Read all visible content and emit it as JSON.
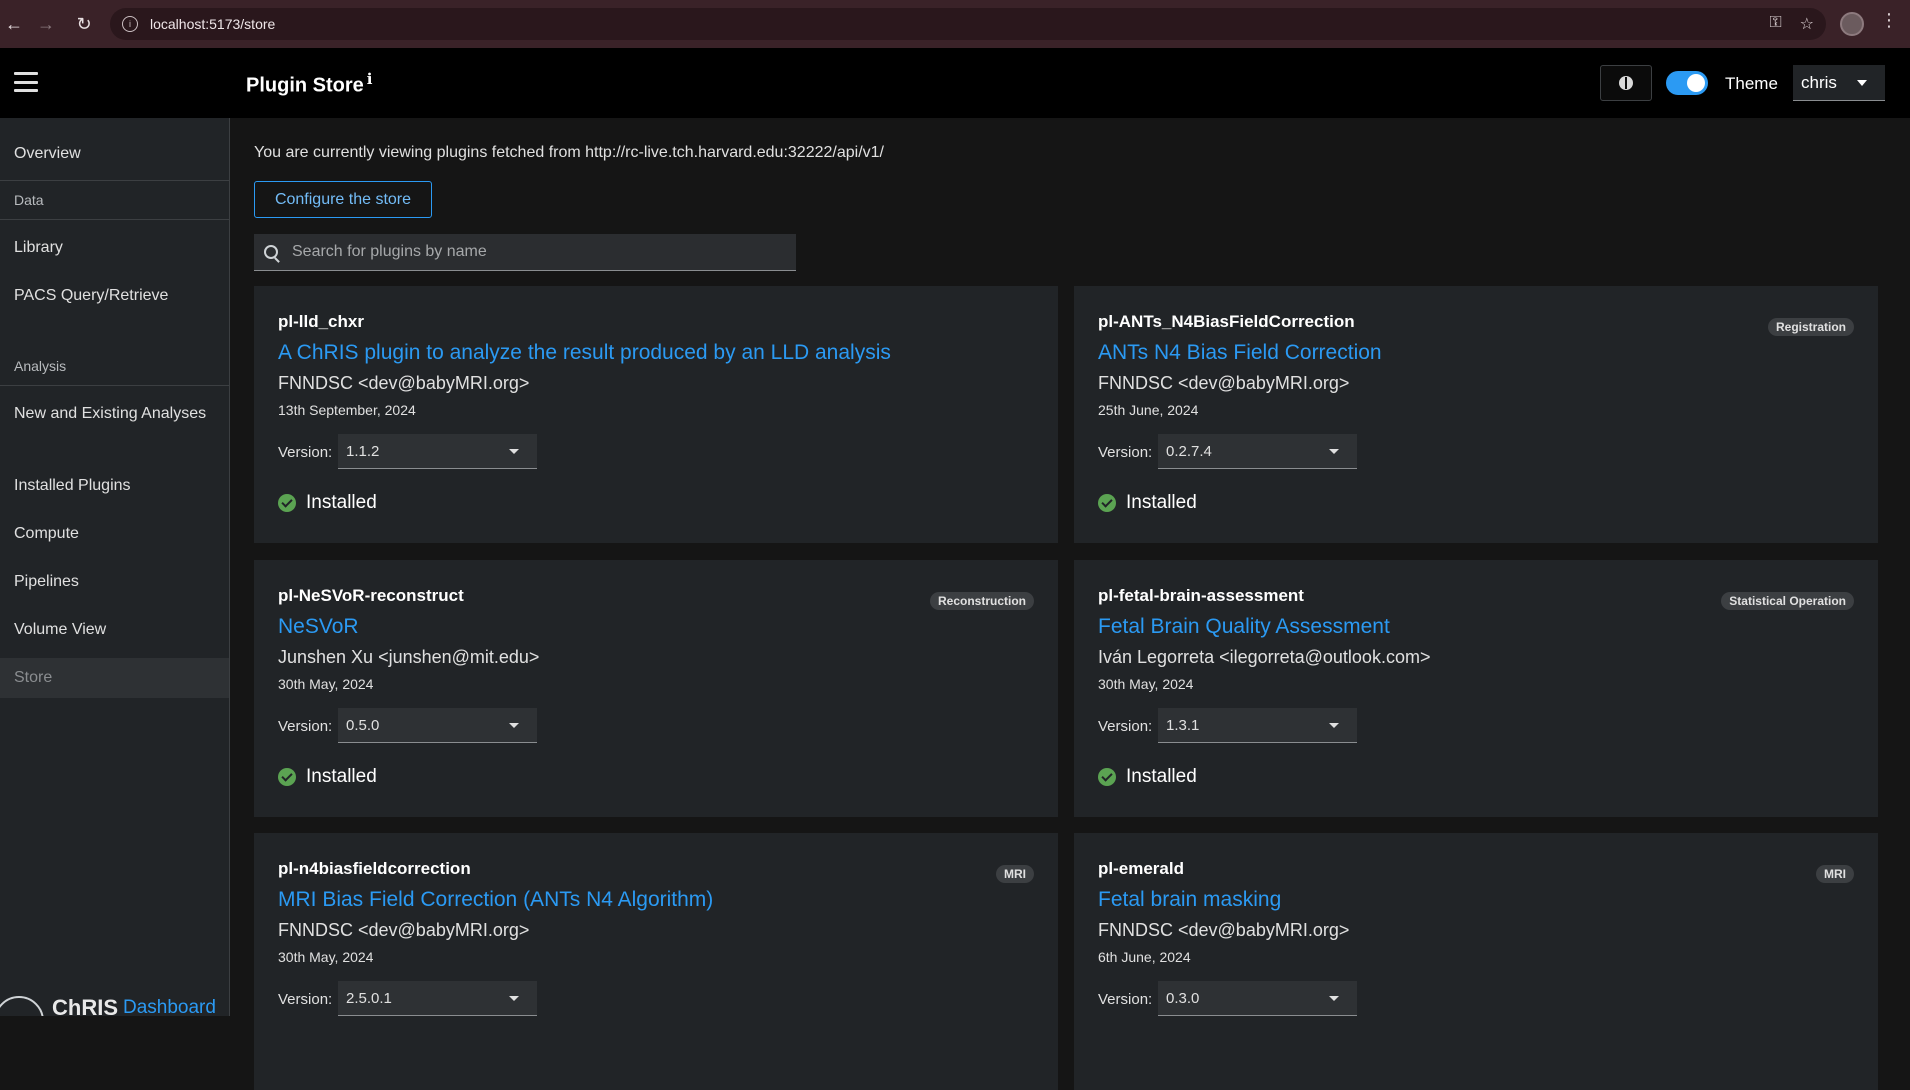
{
  "browser": {
    "url": "localhost:5173/store"
  },
  "header": {
    "title": "Plugin Store",
    "info_symbol": "ℹ",
    "theme_label": "Theme",
    "user": "chris"
  },
  "sidebar": {
    "overview": "Overview",
    "group_data": "Data",
    "library": "Library",
    "pacs": "PACS Query/Retrieve",
    "group_analysis": "Analysis",
    "analyses": "New and Existing Analyses",
    "installed_plugins": "Installed Plugins",
    "compute": "Compute",
    "pipelines": "Pipelines",
    "volume_view": "Volume View",
    "store": "Store",
    "logo_chris": "ChRIS",
    "logo_dashboard": "Dashboard"
  },
  "main": {
    "fetch_text": "You are currently viewing plugins fetched from http://rc-live.tch.harvard.edu:32222/api/v1/",
    "configure_button": "Configure the store",
    "search_placeholder": "Search for plugins by name",
    "version_label": "Version:",
    "installed_label": "Installed"
  },
  "plugins": [
    {
      "name": "pl-lld_chxr",
      "badge": "",
      "title": "A ChRIS plugin to analyze the result produced by an LLD analysis",
      "author": "FNNDSC <dev@babyMRI.org>",
      "date": "13th September, 2024",
      "version": "1.1.2",
      "installed": true
    },
    {
      "name": "pl-ANTs_N4BiasFieldCorrection",
      "badge": "Registration",
      "title": "ANTs N4 Bias Field Correction",
      "author": "FNNDSC <dev@babyMRI.org>",
      "date": "25th June, 2024",
      "version": "0.2.7.4",
      "installed": true
    },
    {
      "name": "pl-NeSVoR-reconstruct",
      "badge": "Reconstruction",
      "title": "NeSVoR",
      "author": "Junshen Xu <junshen@mit.edu>",
      "date": "30th May, 2024",
      "version": "0.5.0",
      "installed": true
    },
    {
      "name": "pl-fetal-brain-assessment",
      "badge": "Statistical Operation",
      "title": "Fetal Brain Quality Assessment",
      "author": "Iván Legorreta <ilegorreta@outlook.com>",
      "date": "30th May, 2024",
      "version": "1.3.1",
      "installed": true
    },
    {
      "name": "pl-n4biasfieldcorrection",
      "badge": "MRI",
      "title": "MRI Bias Field Correction (ANTs N4 Algorithm)",
      "author": "FNNDSC <dev@babyMRI.org>",
      "date": "30th May, 2024",
      "version": "2.5.0.1",
      "installed": false
    },
    {
      "name": "pl-emerald",
      "badge": "MRI",
      "title": "Fetal brain masking",
      "author": "FNNDSC <dev@babyMRI.org>",
      "date": "6th June, 2024",
      "version": "0.3.0",
      "installed": false
    }
  ]
}
